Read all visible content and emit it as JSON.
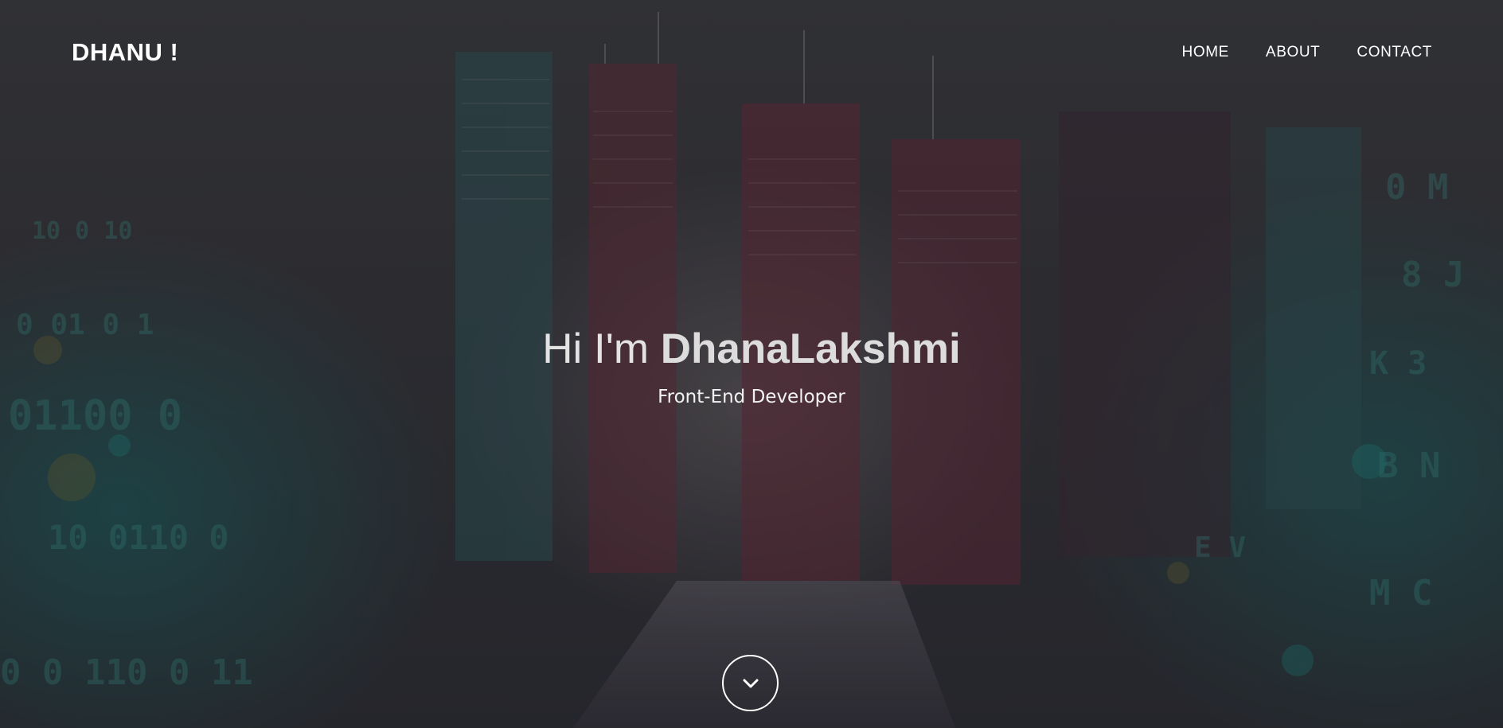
{
  "nav": {
    "brand": "DHANU !",
    "links": [
      "HOME",
      "ABOUT",
      "CONTACT"
    ]
  },
  "hero": {
    "greeting_prefix": "Hi I'm",
    "name": "DhanaLakshmi",
    "role": "Front-End Developer",
    "scroll_icon": "chevron-down-icon"
  },
  "background": {
    "description_icon": "city-matrix-image",
    "accent_color": "#1f8f8a",
    "building_color": "#7a2a3a"
  }
}
